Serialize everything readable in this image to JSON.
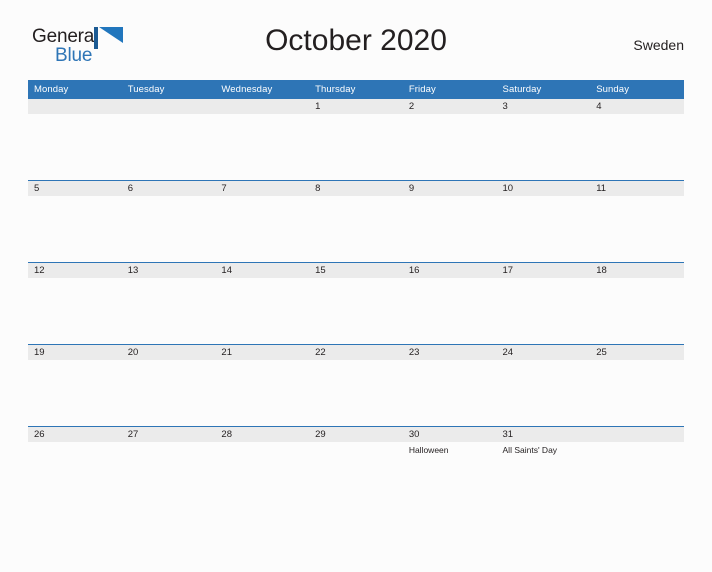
{
  "brand": {
    "name_part1": "General",
    "name_part2": "Blue",
    "mark": "blue-flag-triangle",
    "accent_color": "#2e75b6"
  },
  "header": {
    "title": "October 2020",
    "country": "Sweden"
  },
  "calendar": {
    "weekday_headers": [
      "Monday",
      "Tuesday",
      "Wednesday",
      "Thursday",
      "Friday",
      "Saturday",
      "Sunday"
    ],
    "header_bg": "#2e75b6",
    "day_band_bg": "#ebebeb",
    "weeks": [
      [
        {
          "date": ""
        },
        {
          "date": ""
        },
        {
          "date": ""
        },
        {
          "date": "1"
        },
        {
          "date": "2"
        },
        {
          "date": "3"
        },
        {
          "date": "4"
        }
      ],
      [
        {
          "date": "5"
        },
        {
          "date": "6"
        },
        {
          "date": "7"
        },
        {
          "date": "8"
        },
        {
          "date": "9"
        },
        {
          "date": "10"
        },
        {
          "date": "11"
        }
      ],
      [
        {
          "date": "12"
        },
        {
          "date": "13"
        },
        {
          "date": "14"
        },
        {
          "date": "15"
        },
        {
          "date": "16"
        },
        {
          "date": "17"
        },
        {
          "date": "18"
        }
      ],
      [
        {
          "date": "19"
        },
        {
          "date": "20"
        },
        {
          "date": "21"
        },
        {
          "date": "22"
        },
        {
          "date": "23"
        },
        {
          "date": "24"
        },
        {
          "date": "25"
        }
      ],
      [
        {
          "date": "26"
        },
        {
          "date": "27"
        },
        {
          "date": "28"
        },
        {
          "date": "29"
        },
        {
          "date": "30",
          "event": "Halloween"
        },
        {
          "date": "31",
          "event": "All Saints' Day"
        },
        {
          "date": ""
        }
      ]
    ]
  }
}
